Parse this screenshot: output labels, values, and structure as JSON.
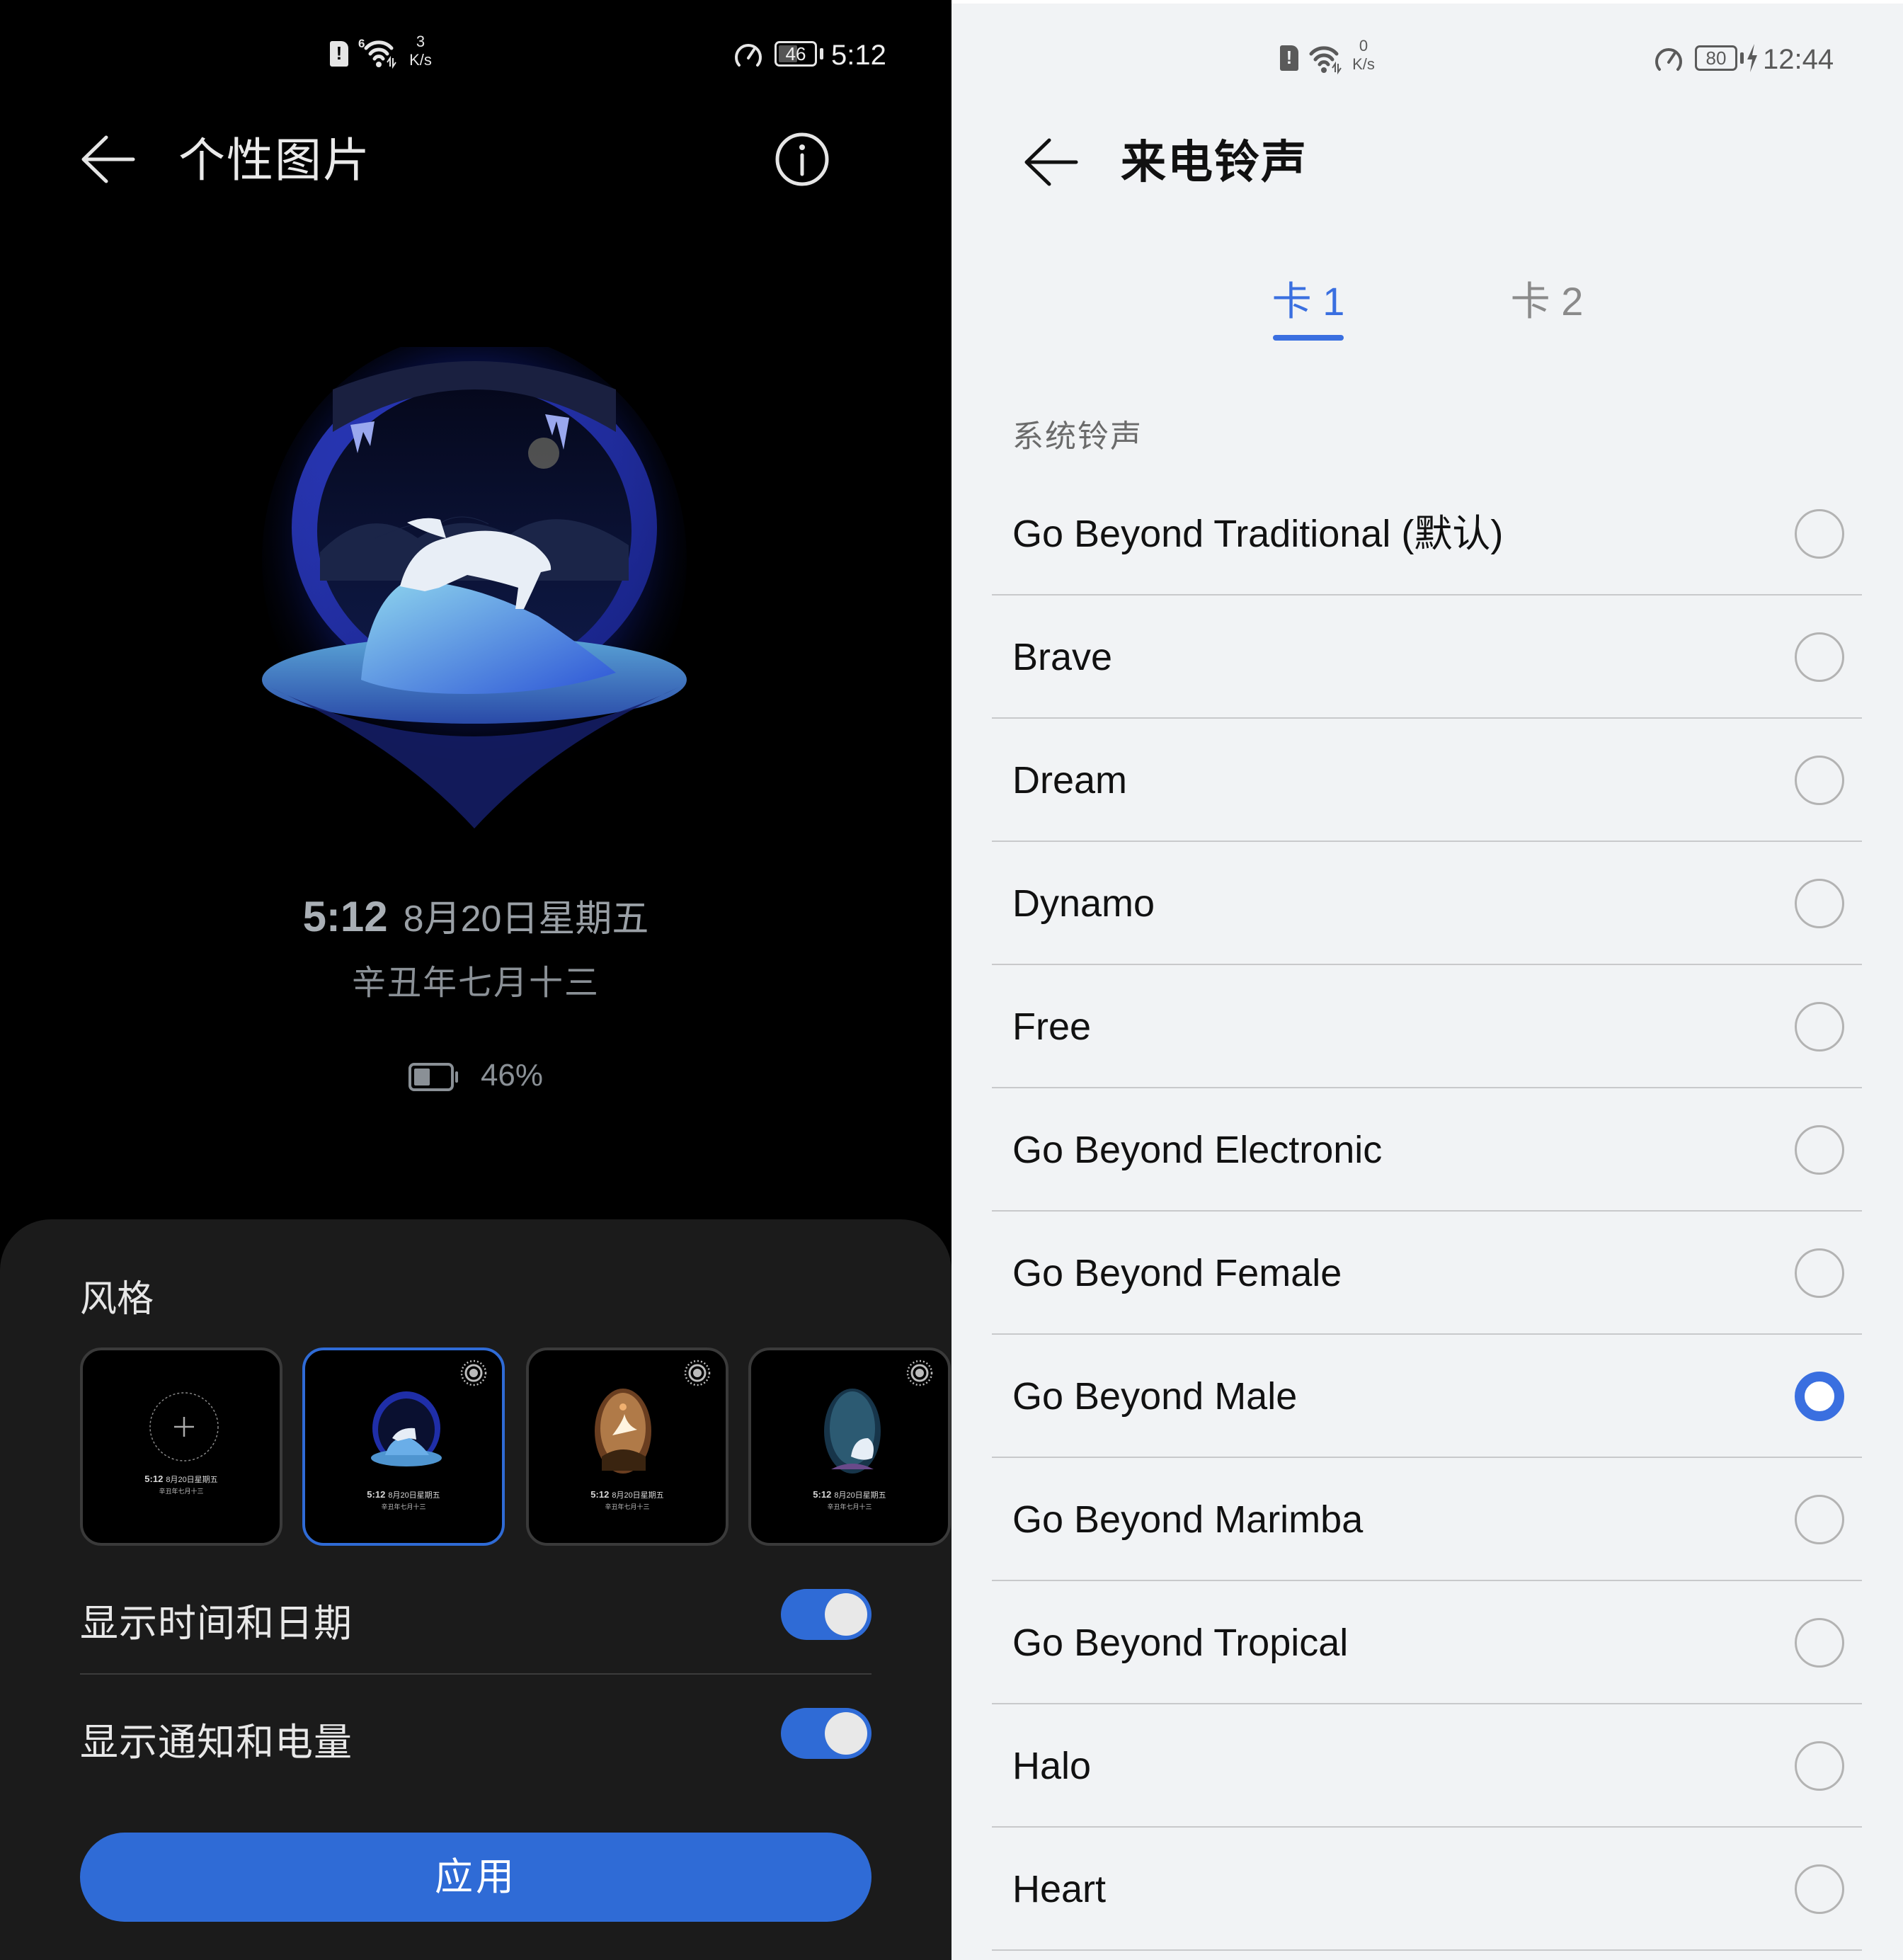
{
  "left_screen": {
    "status_bar": {
      "sim_icon": "sim-alert-icon",
      "wifi_icon": "wifi-6-icon",
      "wifi_generation": "6",
      "net_speed_value": "3",
      "net_speed_unit": "K/s",
      "gauge_icon": "speed-gauge-icon",
      "battery_level": "46",
      "time": "5:12"
    },
    "header": {
      "back_icon": "back-arrow-icon",
      "title": "个性图片",
      "info_icon": "info-icon"
    },
    "preview": {
      "artwork": "polar-bear-ice-cave",
      "time": "5:12",
      "date": "8月20日星期五",
      "lunar_date": "辛丑年七月十三",
      "battery_icon": "battery-icon",
      "battery_percent": "46%",
      "battery_fraction": 0.46
    },
    "sheet": {
      "style_label": "风格",
      "styles": [
        {
          "name": "custom-add",
          "icon": "plus-icon",
          "selected": false,
          "live": false,
          "time": "5:12",
          "date": "8月20日星期五",
          "lunar": "辛丑年七月十三"
        },
        {
          "name": "polar-bear",
          "selected": true,
          "live": true,
          "time": "5:12",
          "date": "8月20日星期五",
          "lunar": "辛丑年七月十三"
        },
        {
          "name": "crane-sunset",
          "selected": false,
          "live": true,
          "time": "5:12",
          "date": "8月20日星期五",
          "lunar": "辛丑年七月十三"
        },
        {
          "name": "beluga-ocean",
          "selected": false,
          "live": true,
          "time": "5:12",
          "date": "8月20日星期五",
          "lunar": "辛丑年七月十三"
        }
      ],
      "toggles": [
        {
          "label": "显示时间和日期",
          "on": true
        },
        {
          "label": "显示通知和电量",
          "on": true
        }
      ],
      "apply_label": "应用"
    },
    "colors": {
      "accent": "#2f6bd6",
      "sheet_bg": "#1b1b1b",
      "bg": "#000000"
    }
  },
  "right_screen": {
    "status_bar": {
      "sim_icon": "sim-alert-icon",
      "wifi_icon": "wifi-icon",
      "net_speed_value": "0",
      "net_speed_unit": "K/s",
      "gauge_icon": "speed-gauge-icon",
      "battery_level": "80",
      "charging_icon": "charging-bolt-icon",
      "time": "12:44"
    },
    "header": {
      "back_icon": "back-arrow-icon",
      "title": "来电铃声"
    },
    "tabs": [
      {
        "label": "卡 1",
        "active": true
      },
      {
        "label": "卡 2",
        "active": false
      }
    ],
    "section_header": "系统铃声",
    "ringtones": [
      {
        "name": "Go Beyond Traditional (默认)",
        "selected": false
      },
      {
        "name": "Brave",
        "selected": false
      },
      {
        "name": "Dream",
        "selected": false
      },
      {
        "name": "Dynamo",
        "selected": false
      },
      {
        "name": "Free",
        "selected": false
      },
      {
        "name": "Go Beyond Electronic",
        "selected": false
      },
      {
        "name": "Go Beyond Female",
        "selected": false
      },
      {
        "name": "Go Beyond Male",
        "selected": true
      },
      {
        "name": "Go Beyond Marimba",
        "selected": false
      },
      {
        "name": "Go Beyond Tropical",
        "selected": false
      },
      {
        "name": "Halo",
        "selected": false
      },
      {
        "name": "Heart",
        "selected": false
      }
    ],
    "colors": {
      "accent": "#3a6fe0",
      "bg": "#f1f3f5",
      "divider": "#c8c9cb"
    }
  }
}
